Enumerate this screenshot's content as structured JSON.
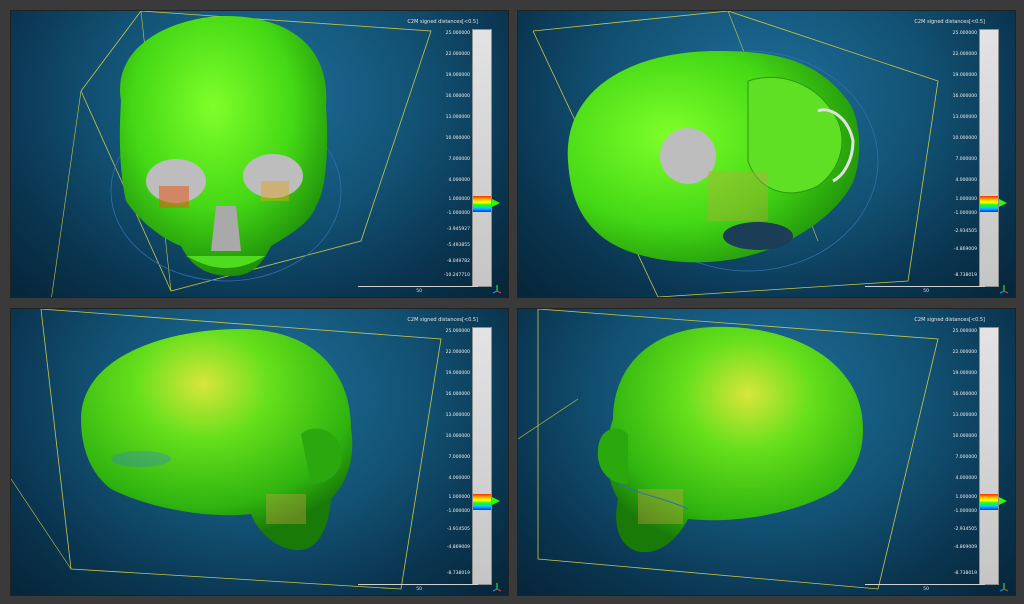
{
  "colors": {
    "viewport_bg": "#125274",
    "mesh_green": "#3ccc12",
    "bbox_line": "#c8c84a"
  },
  "viewports": [
    {
      "view": "front",
      "scalar_field": {
        "title": "C2M signed distances[<0.5]",
        "ticks": [
          "25.000000",
          "22.000000",
          "19.000000",
          "16.000000",
          "13.000000",
          "10.000000",
          "7.000000",
          "4.000000",
          "1.000000",
          "-1.000000",
          "-3.945927",
          "-5.493855",
          "-8.049782",
          "-10.247710"
        ]
      },
      "scale_label": "50"
    },
    {
      "view": "bottom",
      "scalar_field": {
        "title": "C2M signed distances[<0.5]",
        "ticks": [
          "25.000000",
          "22.000000",
          "19.000000",
          "16.000000",
          "13.000000",
          "10.000000",
          "7.000000",
          "4.000000",
          "1.000000",
          "-1.000000",
          "-2.934505",
          "-4.869009",
          "-8.738019"
        ]
      },
      "scale_label": "50"
    },
    {
      "view": "right",
      "scalar_field": {
        "title": "C2M signed distances[<0.5]",
        "ticks": [
          "25.000000",
          "22.000000",
          "19.000000",
          "16.000000",
          "13.000000",
          "10.000000",
          "7.000000",
          "4.000000",
          "1.000000",
          "-1.000000",
          "-3.914505",
          "-4.869009",
          "-8.738019"
        ]
      },
      "scale_label": "50"
    },
    {
      "view": "left",
      "scalar_field": {
        "title": "C2M signed distances[<0.5]",
        "ticks": [
          "25.000000",
          "22.000000",
          "19.000000",
          "16.000000",
          "13.000000",
          "10.000000",
          "7.000000",
          "4.000000",
          "1.000000",
          "-1.000000",
          "-2.934505",
          "-4.869009",
          "-8.738019"
        ]
      },
      "scale_label": "50"
    }
  ]
}
